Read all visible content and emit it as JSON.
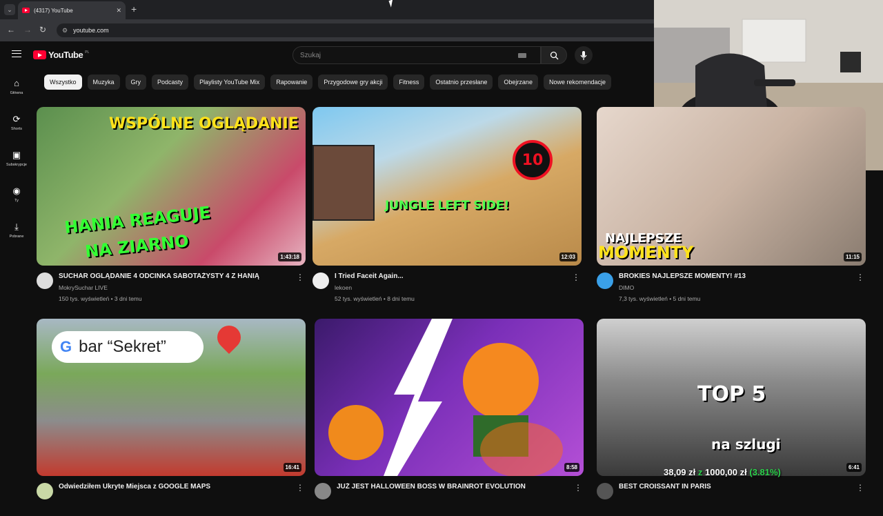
{
  "browser": {
    "tab_title": "(4317) YouTube",
    "url": "youtube.com"
  },
  "header": {
    "logo_text": "YouTube",
    "country_code": "PL",
    "search_placeholder": "Szukaj"
  },
  "sidebar": {
    "items": [
      {
        "label": "Główna",
        "icon": "home-icon"
      },
      {
        "label": "Shorts",
        "icon": "shorts-icon"
      },
      {
        "label": "Subskrypcje",
        "icon": "subscriptions-icon"
      },
      {
        "label": "Ty",
        "icon": "you-icon"
      },
      {
        "label": "Pobrane",
        "icon": "download-icon"
      }
    ]
  },
  "chips": [
    "Wszystko",
    "Muzyka",
    "Gry",
    "Podcasty",
    "Playlisty YouTube Mix",
    "Rapowanie",
    "Przygodowe gry akcji",
    "Fitness",
    "Ostatnio przesłane",
    "Obejrzane",
    "Nowe rekomendacje"
  ],
  "videos": [
    {
      "title": "SUCHAR OGLĄDANIE 4 ODCINKA SABOTAŻYSTY 4 Z HANIĄ",
      "channel": "MokrySuchar LIVE",
      "stats": "150 tys. wyświetleń • 3 dni temu",
      "duration": "1:43:18",
      "overlay1": "WSPÓLNE OGLĄDANIE",
      "overlay2": "HANIA REAGUJE",
      "overlay3": "NA ZIARNO"
    },
    {
      "title": "I Tried Faceit Again...",
      "channel": "lekoen",
      "stats": "52 tys. wyświetleń • 8 dni temu",
      "duration": "12:03",
      "overlay1": "JUNGLE LEFT SIDE!",
      "overlay2": "10"
    },
    {
      "title": "BROKIES NAJLEPSZE MOMENTY! #13",
      "channel": "DIMO",
      "stats": "7,3 tys. wyświetleń • 5 dni temu",
      "duration": "11:15",
      "overlay1": "NAJLEPSZE",
      "overlay2": "MOMENTY"
    },
    {
      "title": "Odwiedziłem Ukryte Miejsca z GOOGLE MAPS",
      "duration": "16:41",
      "overlay1": "bar “Sekret”"
    },
    {
      "title": "JUŻ JEST HALLOWEEN BOSS W BRAINROT EVOLUTION",
      "duration": "8:58"
    },
    {
      "title": "BEST CROISSANT IN PARIS",
      "duration": "6:41",
      "overlay1": "TOP 5",
      "overlay2": "na szlugi"
    }
  ],
  "ticker": {
    "price": "38,09 zł",
    "sep": "z",
    "goal": "1000,00 zł",
    "pct": "(3.81%)"
  }
}
